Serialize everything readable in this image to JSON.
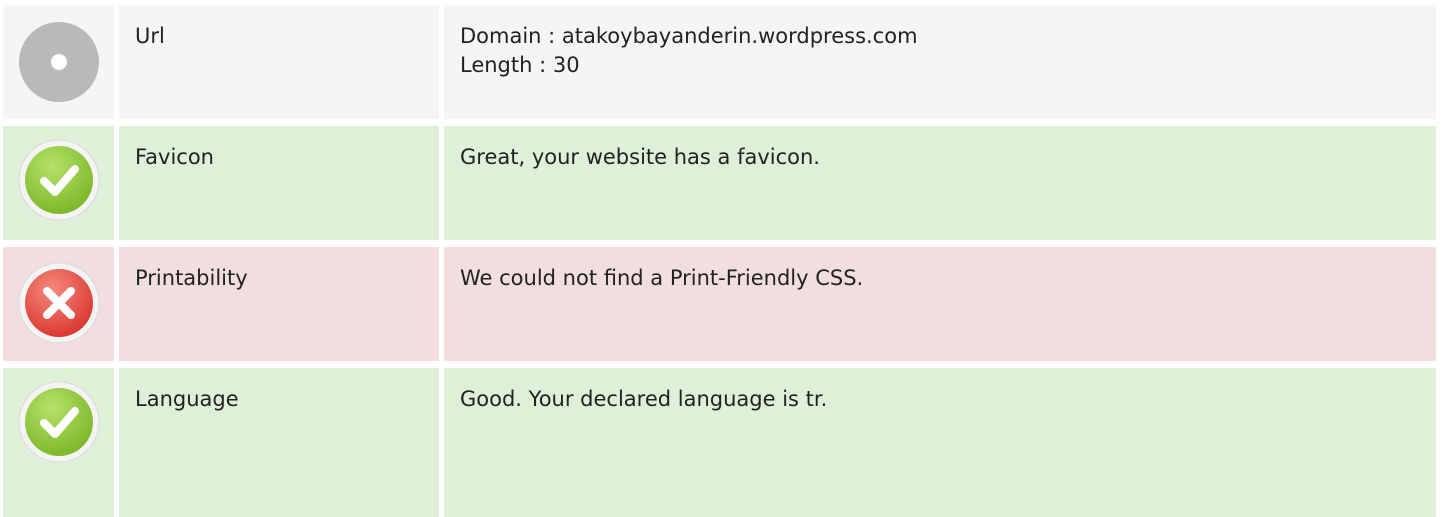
{
  "rows": [
    {
      "status": "neutral",
      "icon": "neutral-circle-icon",
      "label": "Url",
      "lines": [
        "Domain : atakoybayanderin.wordpress.com",
        "Length : 30"
      ]
    },
    {
      "status": "good",
      "icon": "check-circle-icon",
      "label": "Favicon",
      "lines": [
        "Great, your website has a favicon."
      ]
    },
    {
      "status": "bad",
      "icon": "cross-circle-icon",
      "label": "Printability",
      "lines": [
        "We could not find a Print-Friendly CSS."
      ]
    },
    {
      "status": "good",
      "icon": "check-circle-icon",
      "label": "Language",
      "lines": [
        "Good. Your declared language is tr."
      ]
    }
  ],
  "colors": {
    "good_bg": "#dff0d8",
    "bad_bg": "#f2dede",
    "neutral_bg": "#f5f5f5",
    "check_green": "#8cc63f",
    "cross_red": "#e74c3c",
    "neutral_grey": "#b9b9b9"
  }
}
